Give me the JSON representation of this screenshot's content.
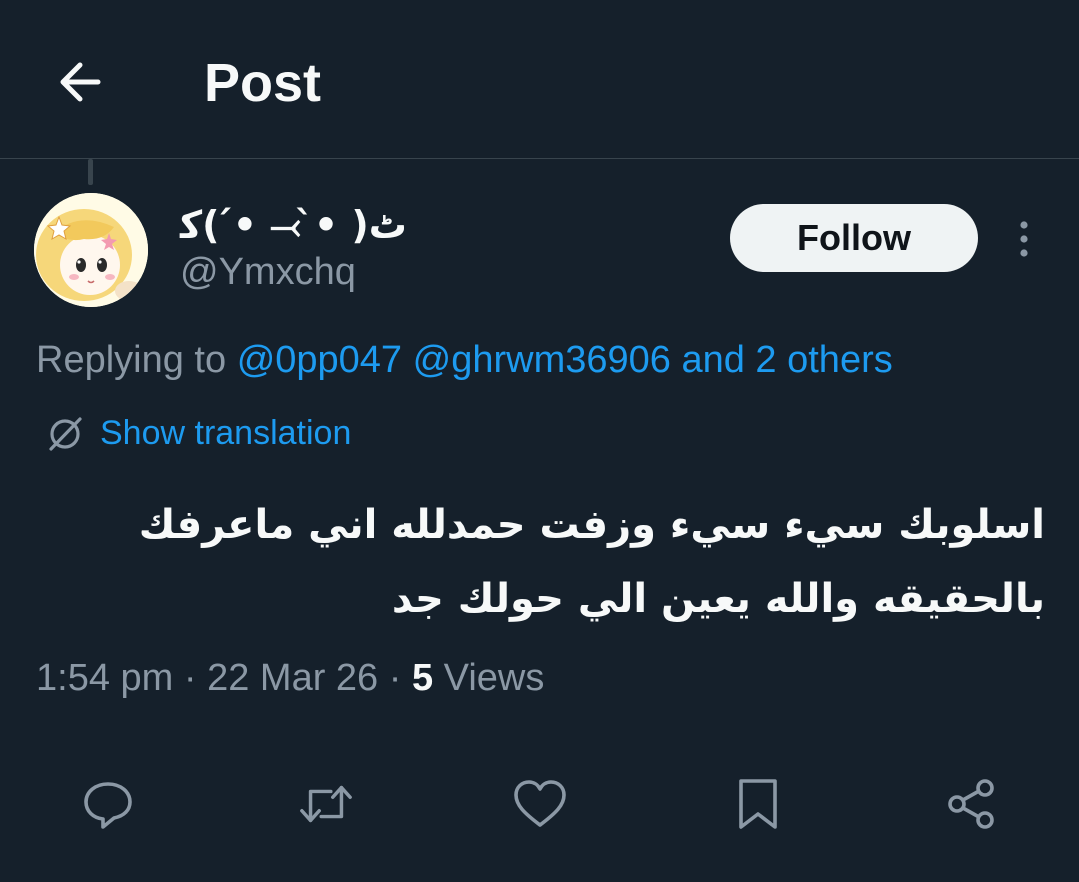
{
  "header": {
    "title": "Post",
    "back_icon": "arrow-left-icon"
  },
  "author": {
    "display_name": "ٹ( •̀ ⤙ •́ )ﮐ",
    "handle": "@Ymxchq",
    "avatar_icon": "avatar-anime-girl",
    "follow_label": "Follow",
    "more_icon": "more-vertical-icon"
  },
  "reply": {
    "prefix": "Replying to",
    "mentions": [
      "@0pp047",
      "@ghrwm36906"
    ],
    "others": "and 2 others"
  },
  "translation": {
    "icon": "globe-slash-icon",
    "label": "Show translation"
  },
  "tweet": {
    "line1": "اسلوبك سيء سيء وزفت حمدلله اني ماعرفك",
    "line2": "بالحقيقه والله يعين الي حولك جد"
  },
  "meta": {
    "time": "1:54 pm",
    "separator": "·",
    "date": "22 Mar 26",
    "views_count": "5",
    "views_label": "Views"
  },
  "actions": {
    "reply_icon": "reply-icon",
    "repost_icon": "repost-icon",
    "like_icon": "heart-icon",
    "bookmark_icon": "bookmark-icon",
    "share_icon": "share-icon"
  },
  "colors": {
    "background": "#15202b",
    "accent": "#1d9bf0",
    "muted_text": "#8b98a5",
    "divider": "#38444d"
  }
}
